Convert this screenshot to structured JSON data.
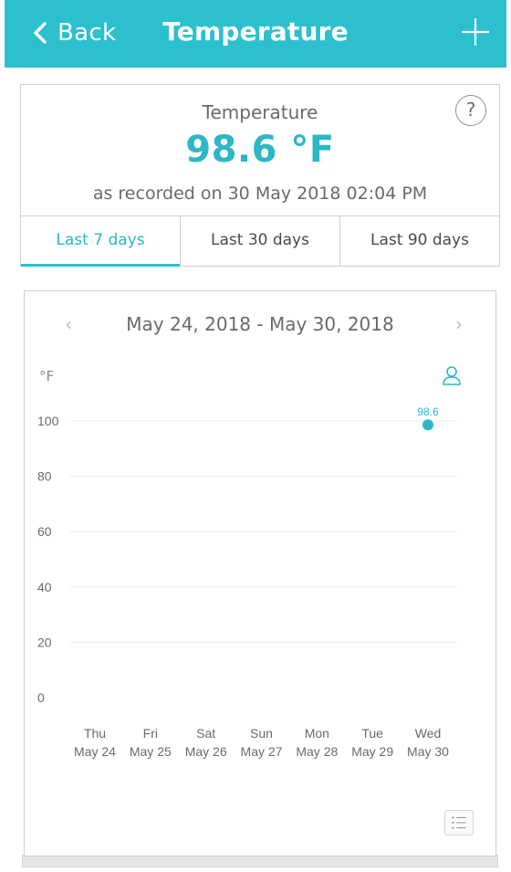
{
  "header": {
    "back_label": "Back",
    "title": "Temperature",
    "add_icon": "plus-icon"
  },
  "summary": {
    "label": "Temperature",
    "value": "98.6 °F",
    "recorded": "as recorded on 30 May 2018 02:04 PM",
    "help_glyph": "?"
  },
  "tabs": [
    {
      "label": "Last 7 days",
      "active": true
    },
    {
      "label": "Last 30 days",
      "active": false
    },
    {
      "label": "Last 90 days",
      "active": false
    }
  ],
  "chart": {
    "range_label": "May 24, 2018 - May 30, 2018",
    "prev_glyph": "‹",
    "next_glyph": "›",
    "unit": "°F"
  },
  "chart_data": {
    "type": "scatter",
    "x_categories": [
      {
        "day": "Thu",
        "date": "May 24"
      },
      {
        "day": "Fri",
        "date": "May 25"
      },
      {
        "day": "Sat",
        "date": "May 26"
      },
      {
        "day": "Sun",
        "date": "May 27"
      },
      {
        "day": "Mon",
        "date": "May 28"
      },
      {
        "day": "Tue",
        "date": "May 29"
      },
      {
        "day": "Wed",
        "date": "May 30"
      }
    ],
    "y_ticks": [
      100,
      80,
      60,
      40,
      20,
      0
    ],
    "ylim": [
      0,
      100
    ],
    "points": [
      {
        "x": "May 30",
        "y": 98.6,
        "label": "98.6"
      }
    ],
    "grid": true,
    "color": "#2cb7c6"
  }
}
